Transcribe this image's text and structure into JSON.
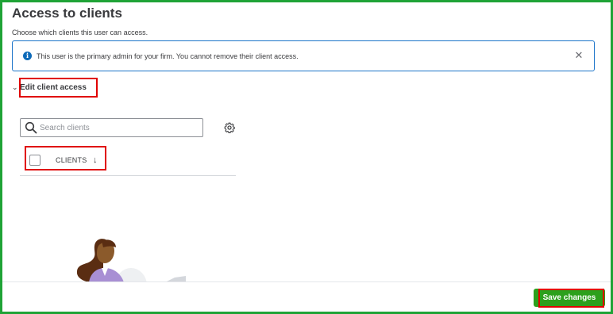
{
  "header": {
    "title": "Access to clients",
    "subtitle": "Choose which clients this user can access."
  },
  "banner": {
    "icon": "info-icon",
    "text": "This user is the primary admin for your firm. You cannot remove their client access.",
    "close_icon": "close-icon"
  },
  "edit_section": {
    "label": "Edit client access",
    "chevron": "chevron-down-icon"
  },
  "search": {
    "placeholder": "Search clients",
    "value": ""
  },
  "table": {
    "column_header": "CLIENTS",
    "sort_indicator": "↓",
    "settings_icon": "gear-icon"
  },
  "footer": {
    "save_label": "Save changes"
  },
  "colors": {
    "frame_border": "#1fa336",
    "annotation_box": "#e00000",
    "info_blue": "#0e6ab8",
    "save_green": "#2ca01c"
  }
}
